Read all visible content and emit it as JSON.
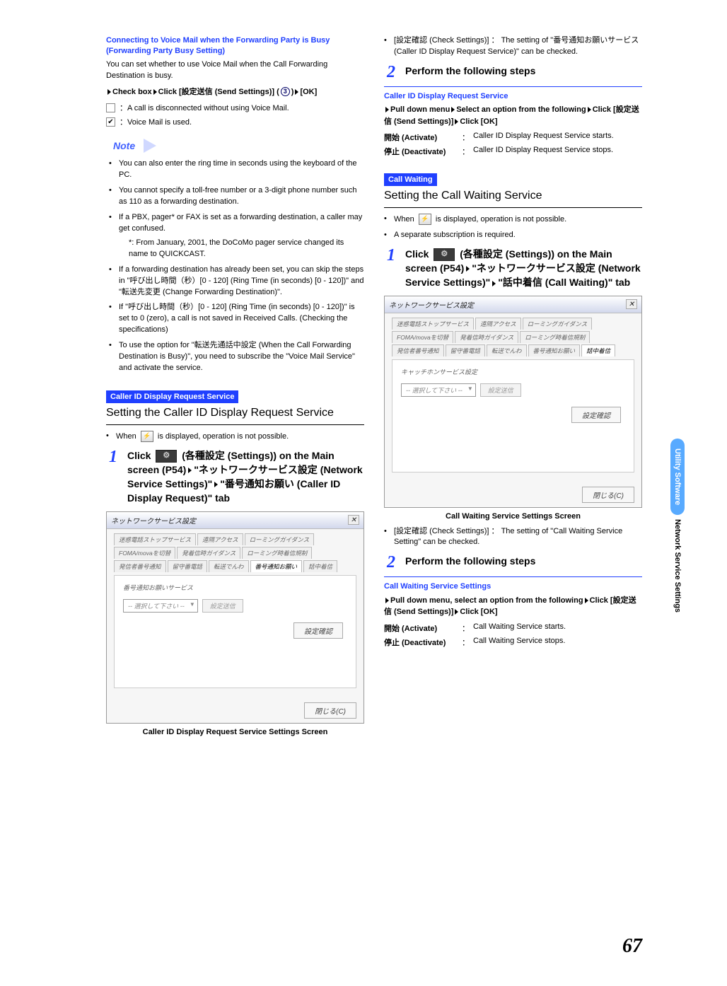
{
  "col1": {
    "h1a": "Connecting to Voice Mail when the Forwarding Party is Busy ",
    "h1b": "(Forwarding Party Busy Setting)",
    "p1": "You can set whether to use Voice Mail when the Call Forwarding Destination is busy.",
    "action1a": "Check box",
    "action1b": "Click [設定送信 (Send Settings)] (",
    "action1c": ")",
    "action1d": "[OK]",
    "cb0": "：A call is disconnected without using Voice Mail.",
    "cb1": "：Voice Mail is used.",
    "noteLabel": "Note",
    "note1": "You can also enter the ring time in seconds using the keyboard of the PC.",
    "note2": "You cannot specify a toll-free number or a 3-digit phone number such as 110 as a forwarding destination.",
    "note3": "If a PBX, pager* or FAX is set as a forwarding destination, a caller may get confused.",
    "note3s": "*: From January, 2001, the DoCoMo pager service changed its name to QUICKCAST.",
    "note4": "If a forwarding destination has already been set, you can skip the steps in \"呼び出し時間（秒）[0 - 120] (Ring Time (in seconds) [0 - 120])\" and \"転送先変更 (Change Forwarding Destination)\".",
    "note5": "If \"呼び出し時間（秒）[0 - 120] (Ring Time (in seconds) [0 - 120])\" is set to 0 (zero), a call is not saved in Received Calls. (Checking the specifications)",
    "note6": "To use the option for \"転送先通話中設定 (When the Call Forwarding Destination is Busy)\", you need to subscribe the \"Voice Mail Service\" and activate the service.",
    "secTag1": "Caller ID Display Request Service",
    "secTitle1": "Setting the Caller ID Display Request Service",
    "when1": "When",
    "when1b": "is displayed, operation is not possible.",
    "step1a": "Click",
    "step1b": "(各種設定 (Settings)) on the Main screen (P54)",
    "step1c": "\"ネットワークサービス設定 (Network Service Settings)\"",
    "step1d": "\"番号通知お願い (Caller ID Display Request)\" tab",
    "ss1Title": "ネットワークサービス設定",
    "ss1Legend": "番号通知お願いサービス",
    "ssSelect": "-- 選択して下さい --",
    "ssBtn1": "設定送信",
    "ssBtn2": "設定確認",
    "ssClose": "閉じる(C)",
    "ssTabs": [
      "迷惑電話ストップサービス",
      "遠隔アクセス",
      "ローミングガイダンス",
      "FOMA/movaを切替",
      "発着信時ガイダンス",
      "ローミング時着信規制",
      "発信者番号通知",
      "留守番電話",
      "転送でんわ",
      "番号通知お願い",
      "話中着信"
    ],
    "caption1": "Caller ID Display Request Service Settings Screen",
    "circ3": "3"
  },
  "col2": {
    "topBul": "[設定確認 (Check Settings)] ： The setting of \"番号通知お願いサービス (Caller ID Display Request Service)\" can be checked.",
    "step2": "Perform the following steps",
    "sub1": "Caller ID Display Request Service",
    "act1a": "Pull down menu",
    "act1b": "Select an option from the following",
    "act1c": "Click [設定送信 (Send Settings)]",
    "act1d": "Click [OK]",
    "d1t": "開始 (Activate)",
    "d1v": "Caller ID Display Request Service starts.",
    "d2t": "停止 (Deactivate)",
    "d2v": "Caller ID Display Request Service stops.",
    "secTag2": "Call Waiting",
    "secTitle2": "Setting the Call Waiting Service",
    "when2a": "When",
    "when2b": "is displayed, operation is not possible.",
    "bul2": "A separate subscription is required.",
    "step3a": "Click",
    "step3b": "(各種設定 (Settings)) on the Main screen (P54)",
    "step3c": "\"ネットワークサービス設定 (Network Service Settings)\"",
    "step3d": "\"話中着信 (Call Waiting)\" tab",
    "ss2Legend": "キャッチホンサービス設定",
    "caption2": "Call Waiting Service Settings Screen",
    "bul3": "[設定確認 (Check Settings)] ： The setting of \"Call Waiting Service Setting\" can be checked.",
    "step4": "Perform the following steps",
    "sub2": "Call Waiting Service Settings",
    "act2a": "Pull down menu, select an option from the following",
    "act2b": "Click [設定送信 (Send Settings)]",
    "act2c": "Click [OK]",
    "d3t": "開始 (Activate)",
    "d3v": "Call Waiting Service starts.",
    "d4t": "停止 (Deactivate)",
    "d4v": "Call Waiting Service stops."
  },
  "side1": "Utility Software",
  "side2": "Network Service Settings",
  "pageNum": "67"
}
